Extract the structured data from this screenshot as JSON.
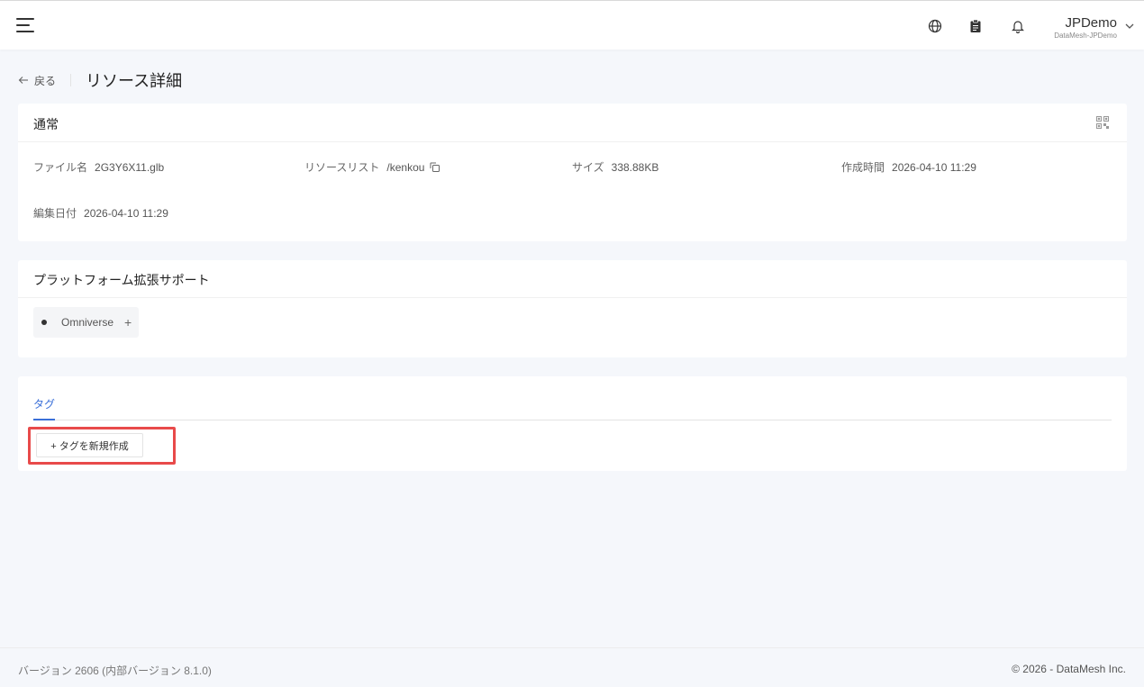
{
  "header": {
    "user_name": "JPDemo",
    "user_org": "DataMesh-JPDemo",
    "icons": [
      "menu-icon",
      "globe-icon",
      "clipboard-icon",
      "bell-icon",
      "chevron-down-icon"
    ]
  },
  "breadcrumb": {
    "back_label": "戻る",
    "title": "リソース詳細"
  },
  "general": {
    "title": "通常",
    "fields": {
      "filename_label": "ファイル名",
      "filename_value": "2G3Y6X11.glb",
      "resource_list_label": "リソースリスト",
      "resource_list_value": "/kenkou",
      "size_label": "サイズ",
      "size_value": "338.88KB",
      "created_label": "作成時間",
      "created_value": "2026-04-10 11:29",
      "edited_label": "編集日付",
      "edited_value": "2026-04-10 11:29"
    }
  },
  "platform": {
    "title": "プラットフォーム拡張サポート",
    "chips": [
      {
        "label": "Omniverse",
        "action": "+"
      }
    ]
  },
  "tags": {
    "tab_label": "タグ",
    "new_tag_button": "+ タグを新規作成"
  },
  "footer": {
    "version": "バージョン 2606 (内部バージョン 8.1.0)",
    "copyright": "© 2026 - DataMesh Inc."
  },
  "colors": {
    "accent": "#3a6fd8",
    "highlight": "#e84a4a",
    "background": "#f5f7fb"
  }
}
